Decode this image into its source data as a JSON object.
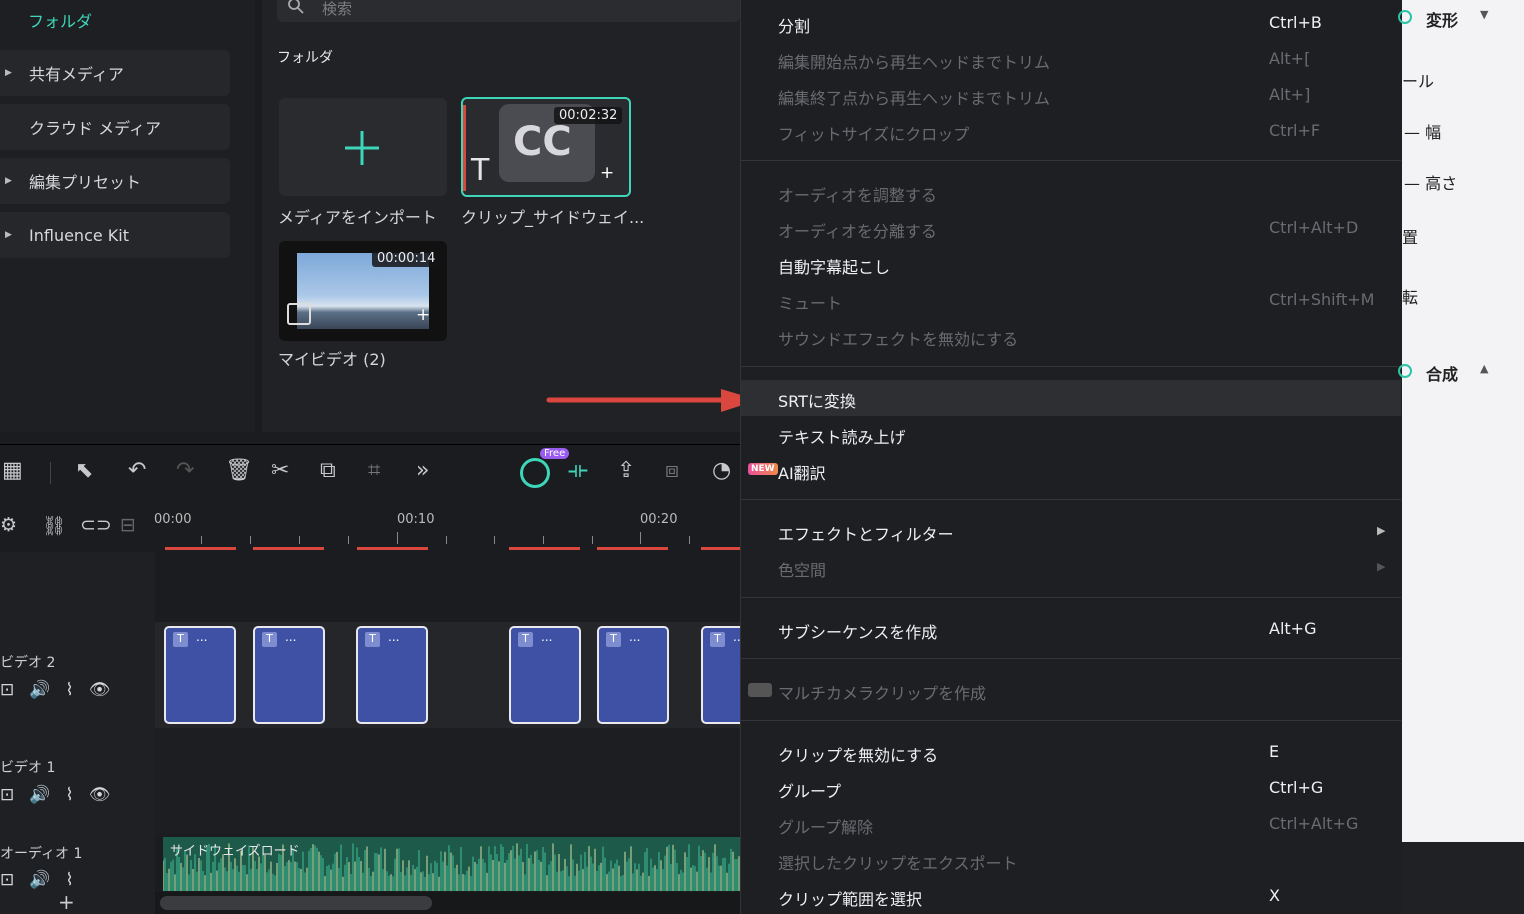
{
  "sidebar": {
    "title": "フォルダ",
    "items": [
      {
        "label": "共有メディア",
        "expandable": true
      },
      {
        "label": "クラウド メディア",
        "expandable": false
      },
      {
        "label": "編集プリセット",
        "expandable": true
      },
      {
        "label": "Influence Kit",
        "expandable": true
      }
    ]
  },
  "media": {
    "search_placeholder": "検索",
    "folder_label": "フォルダ",
    "items": [
      {
        "caption": "メディアをインポート"
      },
      {
        "caption": "クリップ_サイドウェイ...",
        "duration": "00:02:32",
        "badge": "CC"
      },
      {
        "caption": "マイビデオ (2)",
        "duration": "00:00:14"
      }
    ]
  },
  "toolbar": {
    "free_badge": "Free"
  },
  "timeline": {
    "ruler_labels": [
      "00:00",
      "00:10",
      "00:20"
    ],
    "tracks": [
      {
        "name": "ビデオ 2"
      },
      {
        "name": "ビデオ 1"
      },
      {
        "name": "オーディオ 1"
      }
    ],
    "clip_marker": "T",
    "clip_text": "...",
    "audio_clip_label": "サイドウェイズロード"
  },
  "menu": {
    "items": [
      {
        "label": "分割",
        "shortcut": "Ctrl+B",
        "enabled": true
      },
      {
        "label": "編集開始点から再生ヘッドまでトリム",
        "shortcut": "Alt+[",
        "enabled": false
      },
      {
        "label": "編集終了点から再生ヘッドまでトリム",
        "shortcut": "Alt+]",
        "enabled": false
      },
      {
        "label": "フィットサイズにクロップ",
        "shortcut": "Ctrl+F",
        "enabled": false
      },
      {
        "label": "オーディオを調整する",
        "shortcut": "",
        "enabled": false
      },
      {
        "label": "オーディオを分離する",
        "shortcut": "Ctrl+Alt+D",
        "enabled": false
      },
      {
        "label": "自動字幕起こし",
        "shortcut": "",
        "enabled": true
      },
      {
        "label": "ミュート",
        "shortcut": "Ctrl+Shift+M",
        "enabled": false
      },
      {
        "label": "サウンドエフェクトを無効にする",
        "shortcut": "",
        "enabled": false
      },
      {
        "label": "SRTに変換",
        "shortcut": "",
        "enabled": true,
        "highlighted": true
      },
      {
        "label": "テキスト読み上げ",
        "shortcut": "",
        "enabled": true
      },
      {
        "label": "AI翻訳",
        "shortcut": "",
        "enabled": true,
        "badge": "NEW"
      },
      {
        "label": "エフェクトとフィルター",
        "shortcut": "",
        "enabled": true,
        "submenu": true
      },
      {
        "label": "色空間",
        "shortcut": "",
        "enabled": false,
        "submenu": true
      },
      {
        "label": "サブシーケンスを作成",
        "shortcut": "Alt+G",
        "enabled": true
      },
      {
        "label": "マルチカメラクリップを作成",
        "shortcut": "",
        "enabled": false
      },
      {
        "label": "クリップを無効にする",
        "shortcut": "E",
        "enabled": true
      },
      {
        "label": "グループ",
        "shortcut": "Ctrl+G",
        "enabled": true
      },
      {
        "label": "グループ解除",
        "shortcut": "Ctrl+Alt+G",
        "enabled": false
      },
      {
        "label": "選択したクリップをエクスポート",
        "shortcut": "",
        "enabled": false
      },
      {
        "label": "クリップ範囲を選択",
        "shortcut": "X",
        "enabled": true
      }
    ]
  },
  "right_panel": {
    "transform_heading": "変形",
    "rows": [
      "ール",
      "幅",
      "高さ",
      "置",
      "転"
    ],
    "composite_heading": "合成"
  },
  "colors": {
    "accent": "#3ed6b8",
    "highlight_arrow": "#d9473f",
    "clip_blue": "#3e51a4"
  }
}
